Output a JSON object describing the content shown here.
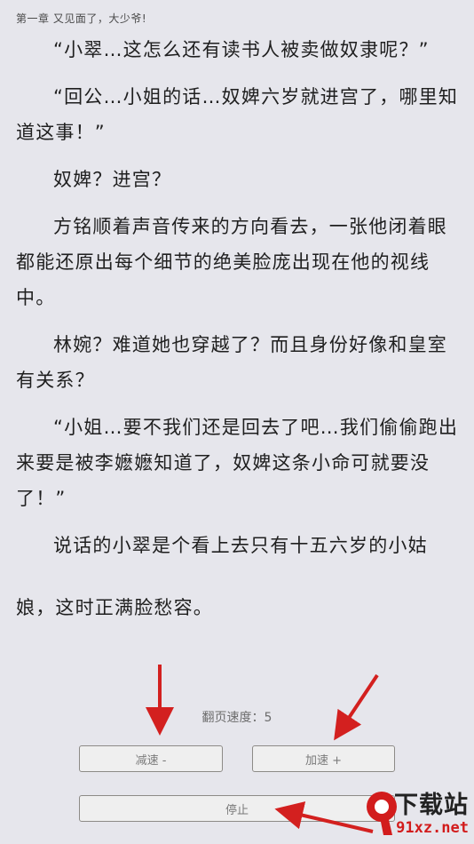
{
  "chapter_title": "第一章 又见面了，大少爷!",
  "paragraphs": [
    "“小翠…这怎么还有读书人被卖做奴隶呢？”",
    "“回公…小姐的话…奴婢六岁就进宫了，哪里知道这事！”",
    "奴婢？进宫？",
    "方铭顺着声音传来的方向看去，一张他闭着眼都能还原出每个细节的绝美脸庞出现在他的视线中。",
    "林婉？难道她也穿越了？而且身份好像和皇室有关系？",
    "“小姐…要不我们还是回去了吧…我们偷偷跑出来要是被李嬷嬷知道了，奴婢这条小命可就要没了！”",
    "说话的小翠是个看上去只有十五六岁的小姑",
    "娘，这时正满脸愁容。"
  ],
  "controls": {
    "speed_label": "翻页速度：5",
    "slow_label": "减速 -",
    "fast_label": "加速 +",
    "stop_label": "停止"
  },
  "watermark": {
    "text": "下载站",
    "url": "91xz.net"
  },
  "colors": {
    "background": "#e6e6ec",
    "arrow": "#d3201f",
    "button_border": "#8d8b87"
  }
}
